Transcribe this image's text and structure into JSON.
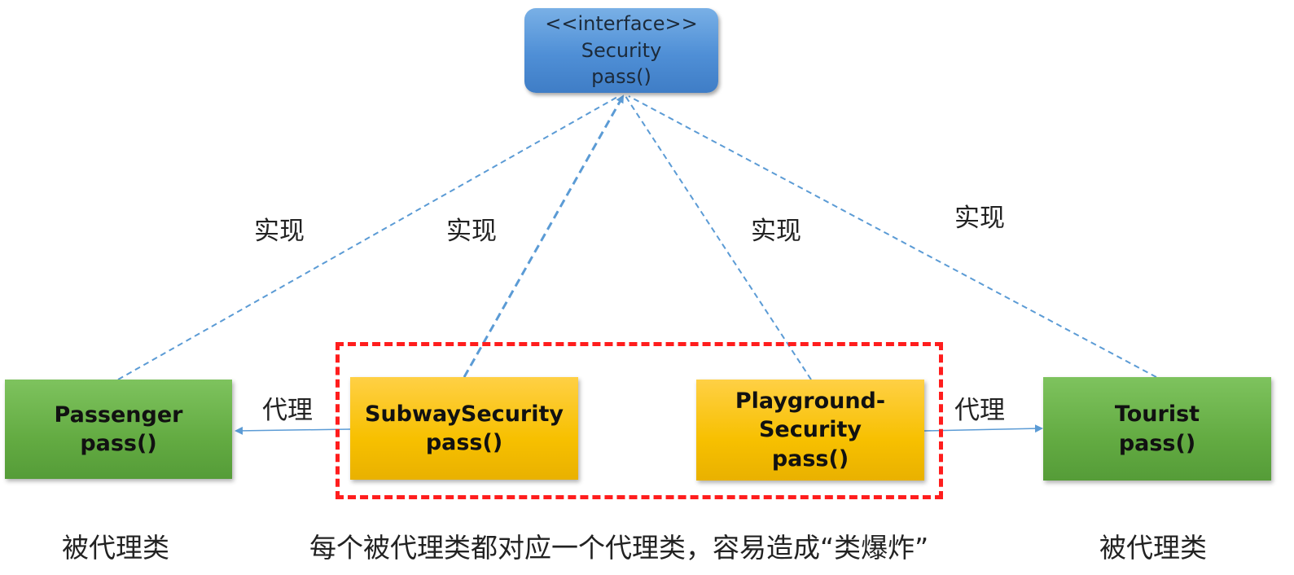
{
  "interface": {
    "stereotype": "<<interface>>",
    "name": "Security",
    "method": "pass()"
  },
  "classes": {
    "passenger": {
      "name": "Passenger",
      "method": "pass()"
    },
    "subway": {
      "name": "SubwaySecurity",
      "method": "pass()"
    },
    "playground": {
      "name_line1": "Playground-",
      "name_line2": "Security",
      "method": "pass()"
    },
    "tourist": {
      "name": "Tourist",
      "method": "pass()"
    }
  },
  "edge_labels": {
    "implements": "实现",
    "proxy": "代理"
  },
  "captions": {
    "left": "被代理类",
    "center": "每个被代理类都对应一个代理类，容易造成“类爆炸”",
    "right": "被代理类"
  },
  "colors": {
    "interface_blue": "#4f8fd6",
    "class_green": "#63ab42",
    "proxy_yellow": "#f7c000",
    "dashed_line": "#5b9bd5",
    "highlight_red": "#ff1d1d"
  }
}
